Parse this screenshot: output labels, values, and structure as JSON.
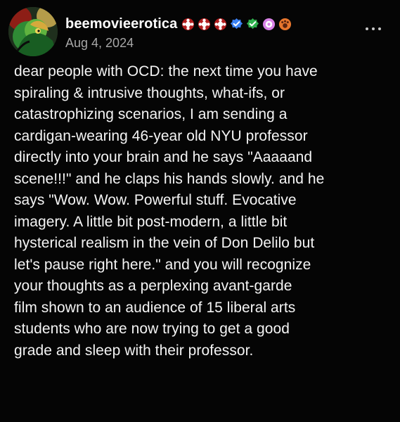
{
  "post": {
    "username": "beemovieerotica",
    "date": "Aug 4, 2024",
    "badges": [
      {
        "name": "flower-badge-icon",
        "color": "#b11d1d"
      },
      {
        "name": "flower-badge-icon",
        "color": "#b11d1d"
      },
      {
        "name": "flower-badge-icon",
        "color": "#b11d1d"
      },
      {
        "name": "verified-badge-icon",
        "color": "#3b82f6"
      },
      {
        "name": "green-check-badge-icon",
        "color": "#2fb04d"
      },
      {
        "name": "purple-flower-badge-icon",
        "color": "#d982e6"
      },
      {
        "name": "orange-paw-badge-icon",
        "color": "#e7762d"
      }
    ],
    "body_lines": [
      "dear people with OCD: the next time you have",
      "spiraling & intrusive thoughts, what-ifs, or",
      "catastrophizing scenarios, I am sending a",
      "cardigan-wearing 46-year old NYU professor",
      "directly into your brain and he says \"Aaaaand",
      "scene!!!\" and he claps his hands slowly. and he",
      "says \"Wow. Wow. Powerful stuff. Evocative",
      "imagery. A little bit post-modern, a little bit",
      "hysterical realism in the vein of Don Delilo but",
      "let's pause right here.\" and you will recognize",
      "your thoughts as a perplexing avant-garde",
      "film shown to an audience of 15 liberal arts",
      "students who are now trying to get a good",
      "grade and sleep with their professor."
    ]
  },
  "colors": {
    "background": "#050505",
    "text": "#f4f4f4",
    "muted": "#a7a7a7"
  },
  "icons": {
    "avatar": "painted-avatar",
    "more": "more-options-icon"
  }
}
